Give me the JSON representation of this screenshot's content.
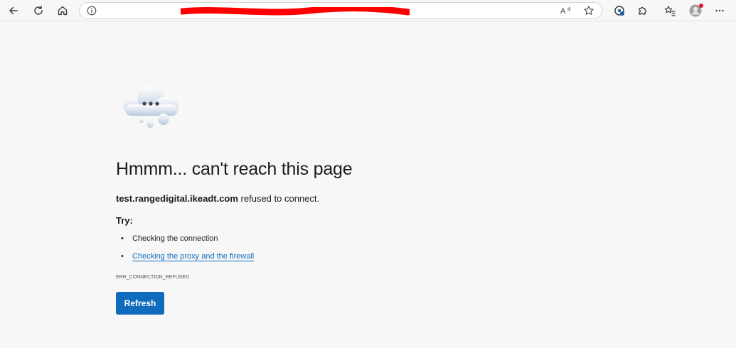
{
  "toolbar": {
    "back_icon": "back-arrow-icon",
    "refresh_icon": "refresh-icon",
    "home_icon": "home-icon",
    "address": {
      "url": "",
      "info_icon": "info-icon",
      "read_aloud_icon": "read-aloud-icon",
      "favorite_icon": "star-icon"
    },
    "extension_icons": [
      "tracking-prevention-icon",
      "extensions-puzzle-icon",
      "favorites-icon",
      "profile-avatar-icon",
      "more-icon"
    ],
    "notification_color": "#e81123"
  },
  "page": {
    "heading": "Hmmm... can't reach this page",
    "host": "test.rangedigital.ikeadt.com",
    "message_suffix": " refused to connect.",
    "try_label": "Try:",
    "suggestions": [
      {
        "text": "Checking the connection",
        "is_link": false
      },
      {
        "text": "Checking the proxy and the firewall",
        "is_link": true
      }
    ],
    "error_code": "ERR_CONNECTION_REFUSED",
    "refresh_label": "Refresh"
  },
  "colors": {
    "background": "#f7f7f7",
    "accent": "#0f6cbd",
    "redaction": "#ff0000"
  }
}
